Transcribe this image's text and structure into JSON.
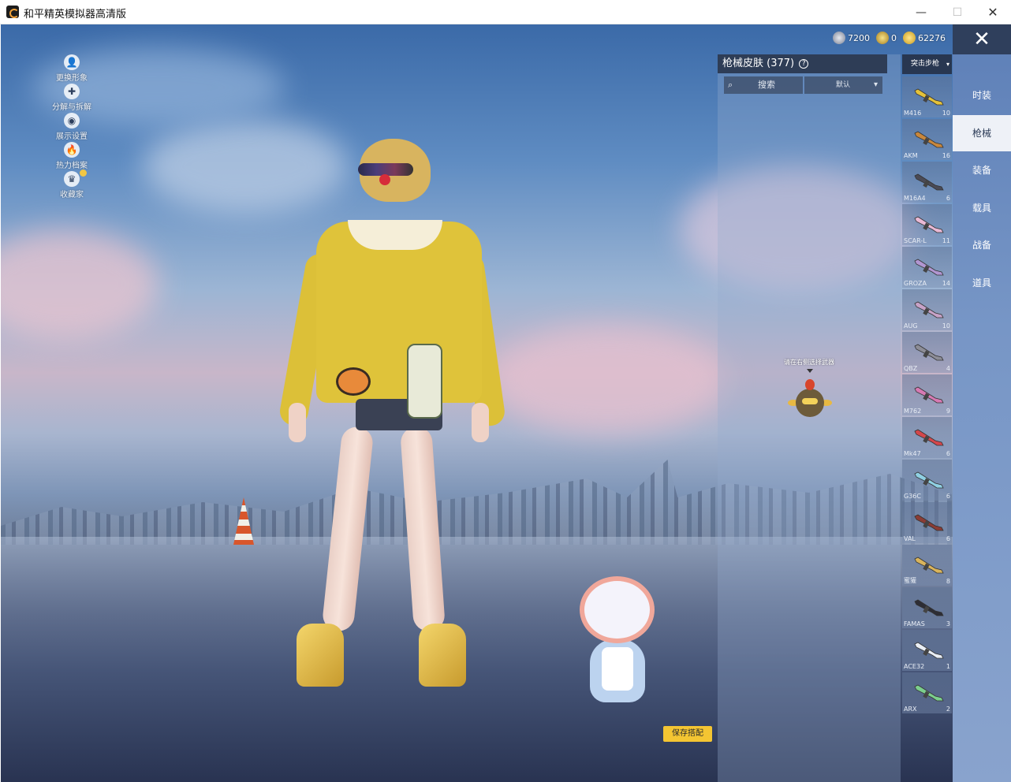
{
  "window": {
    "title": "和平精英模拟器高清版",
    "minimize_icon": "—",
    "maximize_icon": "☐",
    "close_icon": "✕"
  },
  "left_menu": [
    {
      "label": "更换形象",
      "icon": "👤"
    },
    {
      "label": "分解与拆解",
      "icon": "✚"
    },
    {
      "label": "展示设置",
      "icon": "◉"
    },
    {
      "label": "热力档案",
      "icon": "🔥"
    },
    {
      "label": "收藏家",
      "icon": "♛"
    }
  ],
  "currency": [
    {
      "amount": "7200",
      "icon": "silver-coin-icon"
    },
    {
      "amount": "0",
      "icon": "gold-badge-icon"
    },
    {
      "amount": "62276",
      "icon": "gold-coin-icon"
    }
  ],
  "panel": {
    "title": "枪械皮肤 (377)",
    "help_icon": "?",
    "search_placeholder": "搜索",
    "search_icon": "⌕",
    "sort_label": "默认",
    "sort_chevron": "▾",
    "hint": "请在右侧选择武器"
  },
  "weapon_select": {
    "label": "突击步枪",
    "chevron": "▾"
  },
  "weapons": [
    {
      "name": "M416",
      "count": "10",
      "color": "#e4c23a"
    },
    {
      "name": "AKM",
      "count": "16",
      "color": "#c8873c"
    },
    {
      "name": "M16A4",
      "count": "6",
      "color": "#4a4a55"
    },
    {
      "name": "SCAR-L",
      "count": "11",
      "color": "#e9b9d5"
    },
    {
      "name": "GROZA",
      "count": "14",
      "color": "#b196d1"
    },
    {
      "name": "AUG",
      "count": "10",
      "color": "#c7a2c7"
    },
    {
      "name": "QBZ",
      "count": "4",
      "color": "#8d8d96"
    },
    {
      "name": "M762",
      "count": "9",
      "color": "#d77ab3"
    },
    {
      "name": "Mk47",
      "count": "6",
      "color": "#d3474b"
    },
    {
      "name": "G36C",
      "count": "6",
      "color": "#8fd0e3"
    },
    {
      "name": "VAL",
      "count": "6",
      "color": "#8a3c34"
    },
    {
      "name": "蜜獾",
      "count": "8",
      "color": "#d9b45c"
    },
    {
      "name": "FAMAS",
      "count": "3",
      "color": "#2d2d35"
    },
    {
      "name": "ACE32",
      "count": "1",
      "color": "#e9eef5"
    },
    {
      "name": "ARX",
      "count": "2",
      "color": "#7ccf8d"
    }
  ],
  "categories": [
    {
      "label": "时装",
      "active": false
    },
    {
      "label": "枪械",
      "active": true
    },
    {
      "label": "装备",
      "active": false
    },
    {
      "label": "载具",
      "active": false
    },
    {
      "label": "战备",
      "active": false
    },
    {
      "label": "道具",
      "active": false
    }
  ],
  "close_label": "✕",
  "save_label": "保存搭配"
}
